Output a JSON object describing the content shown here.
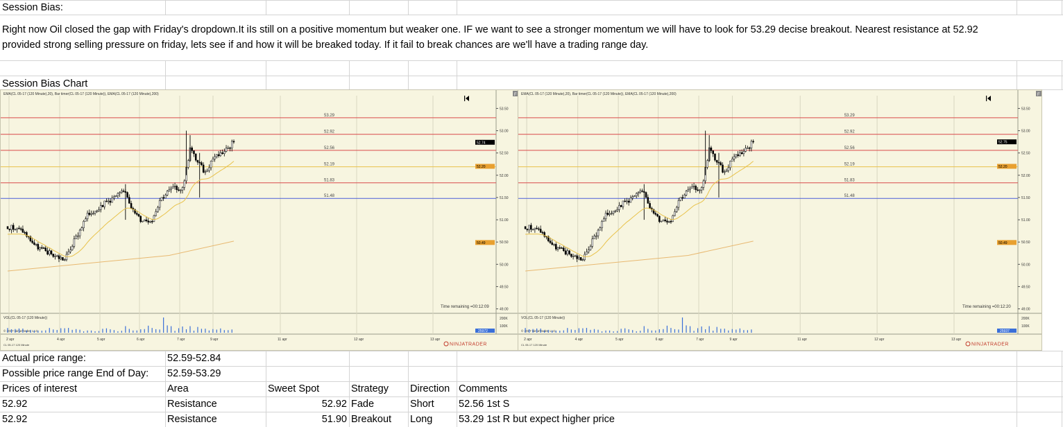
{
  "sheet": {
    "title_cell": "Session Bias:",
    "paragraph": "Right now Oil closed the gap with Friday's dropdown.It iIs still on a positive momentum but weaker one. IF we want to see a stronger momentum we will have to look for 53.29 decise breakout. Nearest resistance at 52.92 provided strong selling pressure on friday, lets see if and how it will be breaked today. If it fail to break chances are we'll have a trading range day.",
    "chart_title": "Session Bias Chart",
    "actual_range_label": "Actual price range:",
    "actual_range_value": "52.59-52.84",
    "possible_range_label": "Possible price range End of Day:",
    "possible_range_value": "52.59-53.29",
    "table_headers": [
      "Prices of interest",
      "Area",
      "Sweet Spot",
      "Strategy",
      "Direction",
      "Comments"
    ],
    "table_rows": [
      [
        "52.92",
        "Resistance",
        "52.92",
        "Fade",
        "Short",
        "52.56 1st S"
      ],
      [
        "52.92",
        "Resistance",
        "51.90",
        "Breakout",
        "Long",
        "53.29 1st R but expect higher price"
      ]
    ]
  },
  "charts": [
    {
      "header": "EMA(CL 05-17 (120 Minute),20), Bar timer(CL 05-17 (120 Minute)), EMA(CL 05-17 (120 Minute),200)",
      "levels": [
        53.29,
        52.92,
        52.56,
        52.19,
        51.83,
        51.48
      ],
      "axis_ticks": [
        "53.50",
        "53.00",
        "52.50",
        "52.00",
        "51.50",
        "51.00",
        "50.50",
        "50.00",
        "49.50",
        "49.00"
      ],
      "last_price": "52.74",
      "ema20_label": "52.20",
      "ema200_label": "50.49",
      "time_remaining": "Time remaining =00:12:09",
      "vol_label": "VOL(CL 05-17 (120 Minute))",
      "vol_ticks": [
        "200K",
        "100K"
      ],
      "vol_value": "25972",
      "copyright": "© 2017 NinjaTrader, LLC",
      "instrument": "CL 05-17 120 Minute",
      "dates": [
        "2 apr",
        "4 apr",
        "5 apr",
        "6 apr",
        "7 apr",
        "9 apr",
        "11 apr",
        "12 apr",
        "13 apr"
      ],
      "brand": "NINJATRADER"
    },
    {
      "header": "EMA(CL 05-17 (120 Minute),20), Bar timer(CL 05-17 (120 Minute)), EMA(CL 05-17 (120 Minute),200)",
      "levels": [
        53.29,
        52.92,
        52.56,
        52.19,
        51.83,
        51.48
      ],
      "axis_ticks": [
        "53.50",
        "53.00",
        "52.50",
        "52.00",
        "51.50",
        "51.00",
        "50.50",
        "50.00",
        "49.50",
        "49.00"
      ],
      "last_price": "52.75",
      "ema20_label": "52.20",
      "ema200_label": "50.49",
      "time_remaining": "Time remaining =00:12:20",
      "vol_label": "VOL(CL 05-17 (120 Minute))",
      "vol_ticks": [
        "200K",
        "100K"
      ],
      "vol_value": "25937",
      "copyright": "© 2017 NinjaTrader, LLC",
      "instrument": "CL 05-17 120 Minute",
      "dates": [
        "2 apr",
        "4 apr",
        "5 apr",
        "6 apr",
        "7 apr",
        "9 apr",
        "11 apr",
        "12 apr",
        "13 apr"
      ],
      "brand": "NINJATRADER"
    }
  ],
  "colors": {
    "chart_bg": "#f7f5e0",
    "resistance_line": "#d94a4a",
    "ema20_line": "#e8c24a",
    "support_line": "#4a5fd9",
    "ema200_line": "#e8b870",
    "price_badge": "#000000",
    "ema_badge": "#e8a030"
  },
  "icons": [
    "bar-start-icon",
    "panel-f-icon",
    "ninjatrader-logo-icon"
  ]
}
